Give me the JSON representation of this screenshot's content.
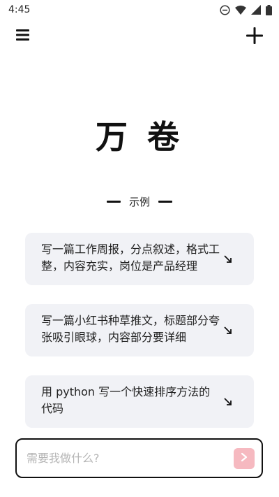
{
  "status_bar": {
    "time": "4:45",
    "icons": [
      "dnd-icon",
      "wifi-icon",
      "signal-icon",
      "battery-icon"
    ]
  },
  "top_bar": {
    "menu_icon": "hamburger-menu-icon",
    "new_icon": "plus-icon"
  },
  "app": {
    "title": "万 卷"
  },
  "examples": {
    "header": "示例",
    "items": [
      {
        "text": "写一篇工作周报，分点叙述，格式工整，内容充实，岗位是产品经理",
        "icon": "arrow-down-right-icon"
      },
      {
        "text": "写一篇小红书种草推文，标题部分夸张吸引眼球，内容部分要详细",
        "icon": "arrow-down-right-icon"
      },
      {
        "text": "用 python 写一个快速排序方法的代码",
        "icon": "arrow-down-right-icon"
      }
    ]
  },
  "input": {
    "placeholder": "需要我做什么?",
    "value": "",
    "send_icon": "chevron-right-icon"
  },
  "colors": {
    "background": "#ffffff",
    "card_background": "#f1f2f6",
    "send_button": "#f6b9c0",
    "text": "#111111"
  }
}
